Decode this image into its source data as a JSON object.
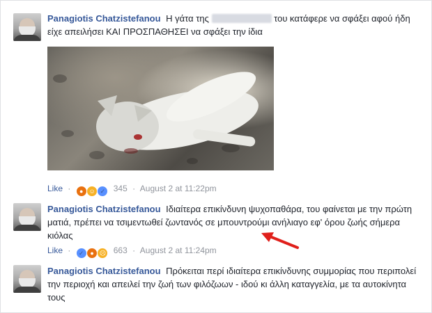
{
  "comments": [
    {
      "author": "Panagiotis Chatzistefanou",
      "text_before": "Η γάτα της",
      "text_after": "του κατάφερε να σφάξει αφού ήδη είχε απειλήσει ΚΑΙ ΠΡΟΣΠΑΘΗΣΕΙ να σφάξει την ίδια",
      "reactions": [
        "angry-reaction",
        "haha-reaction",
        "like-reaction"
      ],
      "like_label": "Like",
      "count": "345",
      "timestamp": "August 2 at 11:22pm"
    },
    {
      "author": "Panagiotis Chatzistefanou",
      "text": "Ιδιαίτερα επικίνδυνη ψυχοπαθάρα, του φαίνεται με την πρώτη ματιά, πρέπει να τσιμεντωθεί ζωντανός σε μπουντρούμι ανήλιαγο εφ' όρου ζωής σήμερα κιόλας",
      "reactions": [
        "like-reaction",
        "angry-reaction",
        "sad-reaction"
      ],
      "like_label": "Like",
      "count": "663",
      "timestamp": "August 2 at 11:24pm"
    },
    {
      "author": "Panagiotis Chatzistefanou",
      "text": "Πρόκειται περί ιδιαίτερα επικίνδυνης συμμορίας που περιπολεί την περιοχή και απειλεί την ζωή των φιλόζωων - ιδού κι άλλη καταγγελία, με τα αυτοκίνητα τους"
    }
  ],
  "separator": "·",
  "colors": {
    "author": "#365899",
    "arrow": "#e0201b",
    "meta": "#90949c"
  }
}
